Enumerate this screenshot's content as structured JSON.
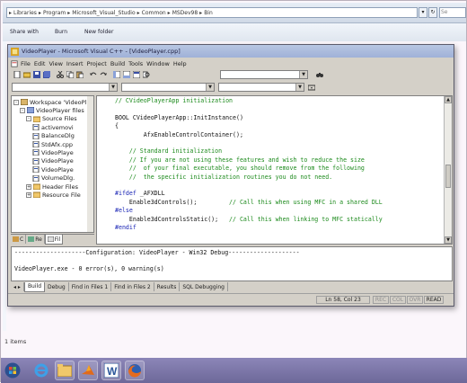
{
  "explorer": {
    "breadcrumbs": [
      "Libraries",
      "Program",
      "Microsoft_Visual_Studio",
      "Common",
      "MSDev98",
      "Bin"
    ],
    "search_placeholder": "Se",
    "commands": [
      "Share with",
      "Burn",
      "New folder"
    ],
    "status_count": "1 items"
  },
  "vc": {
    "title": "VideoPlayer - Microsoft Visual C++ - [VideoPlayer.cpp]",
    "menu": [
      "File",
      "Edit",
      "View",
      "Insert",
      "Project",
      "Build",
      "Tools",
      "Window",
      "Help"
    ],
    "workspace": {
      "tree": [
        {
          "label": "Workspace 'VideoPl",
          "icon": "workspace-icon",
          "pm": "-",
          "level": 0
        },
        {
          "label": "VideoPlayer files",
          "icon": "project-icon",
          "pm": "-",
          "level": 1
        },
        {
          "label": "Source Files",
          "icon": "folder-icon",
          "pm": "-",
          "level": 2
        },
        {
          "label": "activemovi",
          "icon": "file-icon",
          "pm": "",
          "level": 3
        },
        {
          "label": "BalanceDlg",
          "icon": "file-icon",
          "pm": "",
          "level": 3
        },
        {
          "label": "StdAfx.cpp",
          "icon": "file-icon",
          "pm": "",
          "level": 3
        },
        {
          "label": "VideoPlaye",
          "icon": "file-icon",
          "pm": "",
          "level": 3
        },
        {
          "label": "VideoPlaye",
          "icon": "file-icon",
          "pm": "",
          "level": 3
        },
        {
          "label": "VideoPlaye",
          "icon": "file-icon",
          "pm": "",
          "level": 3
        },
        {
          "label": "VolumeDlg.",
          "icon": "file-icon",
          "pm": "",
          "level": 3
        },
        {
          "label": "Header Files",
          "icon": "folder-icon",
          "pm": "+",
          "level": 2
        },
        {
          "label": "Resource File",
          "icon": "folder-icon",
          "pm": "+",
          "level": 2
        }
      ],
      "tabs": [
        {
          "label": "C",
          "icon": "classview-icon"
        },
        {
          "label": "Re",
          "icon": "resourceview-icon"
        },
        {
          "label": "Fil",
          "icon": "fileview-icon"
        }
      ]
    },
    "code_lines": [
      {
        "type": "cmt",
        "text": "// CVideoPlayerApp initialization"
      },
      {
        "type": "tx",
        "text": ""
      },
      {
        "type": "tx",
        "text": "BOOL CVideoPlayerApp::InitInstance()"
      },
      {
        "type": "tx",
        "text": "{"
      },
      {
        "type": "tx",
        "text": "        AfxEnableControlContainer();"
      },
      {
        "type": "tx",
        "text": ""
      },
      {
        "type": "cmt",
        "text": "    // Standard initialization"
      },
      {
        "type": "cmt",
        "text": "    // If you are not using these features and wish to reduce the size"
      },
      {
        "type": "cmt",
        "text": "    //  of your final executable, you should remove from the following"
      },
      {
        "type": "cmt",
        "text": "    //  the specific initialization routines you do not need."
      },
      {
        "type": "tx",
        "text": ""
      },
      {
        "type": "mix",
        "kw": "#ifdef",
        "rest": " _AFXDLL"
      },
      {
        "type": "mix2",
        "code": "    Enable3dControls();",
        "comment": "         // Call this when using MFC in a shared DLL"
      },
      {
        "type": "kw",
        "text": "#else"
      },
      {
        "type": "mix2",
        "code": "    Enable3dControlsStatic();",
        "comment": "   // Call this when linking to MFC statically"
      },
      {
        "type": "kw",
        "text": "#endif"
      }
    ],
    "output_lines": [
      "--------------------Configuration: VideoPlayer - Win32 Debug--------------------",
      "",
      "VideoPlayer.exe - 0 error(s), 0 warning(s)"
    ],
    "output_tabs": [
      "Build",
      "Debug",
      "Find in Files 1",
      "Find in Files 2",
      "Results",
      "SQL Debugging"
    ],
    "status": {
      "position": "Ln 58, Col 23",
      "rec": "REC",
      "col": "COL",
      "ovr": "OVR",
      "read": "READ"
    }
  },
  "taskbar": {
    "apps": [
      "start-orb-icon",
      "ie-icon",
      "folder-icon",
      "matlab-icon",
      "word-icon",
      "firefox-icon"
    ]
  }
}
